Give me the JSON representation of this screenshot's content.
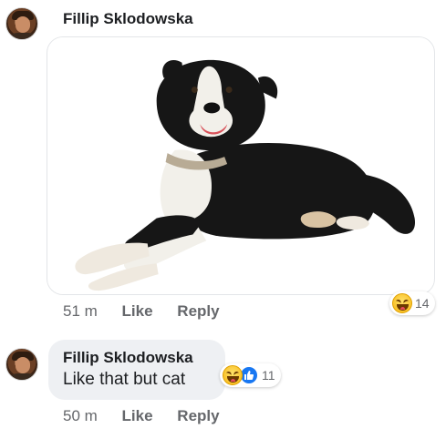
{
  "post_comment": {
    "author": "Fillip Sklodowska",
    "attachment": {
      "kind": "photo",
      "subject": "border-collie-dog"
    },
    "time": "51 m",
    "like_label": "Like",
    "reply_label": "Reply",
    "reactions": {
      "icons": [
        "haha-emoji-icon"
      ],
      "count": "14"
    }
  },
  "reply_comment": {
    "author": "Fillip Sklodowska",
    "text": "Like that but cat",
    "time": "50 m",
    "like_label": "Like",
    "reply_label": "Reply",
    "reactions": {
      "icons": [
        "haha-emoji-icon",
        "like-emoji-icon"
      ],
      "count": "11"
    }
  },
  "colors": {
    "meta_text": "#65676b",
    "bubble_bg": "#eef0f3",
    "like_blue": "#1877f2"
  }
}
